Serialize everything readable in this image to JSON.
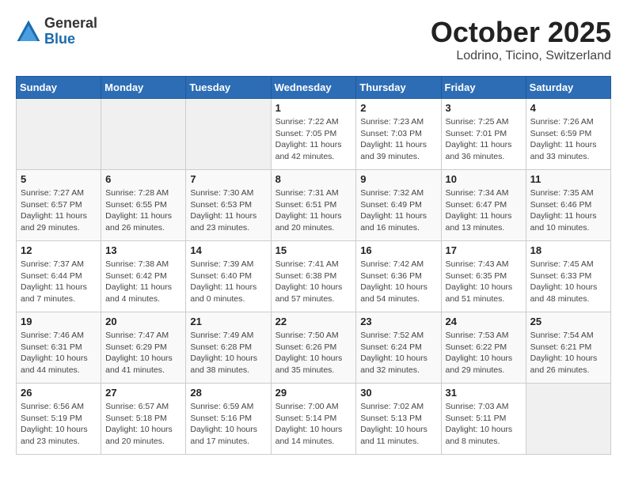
{
  "logo": {
    "general": "General",
    "blue": "Blue"
  },
  "header": {
    "title": "October 2025",
    "subtitle": "Lodrino, Ticino, Switzerland"
  },
  "weekdays": [
    "Sunday",
    "Monday",
    "Tuesday",
    "Wednesday",
    "Thursday",
    "Friday",
    "Saturday"
  ],
  "weeks": [
    [
      {
        "day": "",
        "info": ""
      },
      {
        "day": "",
        "info": ""
      },
      {
        "day": "",
        "info": ""
      },
      {
        "day": "1",
        "info": "Sunrise: 7:22 AM\nSunset: 7:05 PM\nDaylight: 11 hours\nand 42 minutes."
      },
      {
        "day": "2",
        "info": "Sunrise: 7:23 AM\nSunset: 7:03 PM\nDaylight: 11 hours\nand 39 minutes."
      },
      {
        "day": "3",
        "info": "Sunrise: 7:25 AM\nSunset: 7:01 PM\nDaylight: 11 hours\nand 36 minutes."
      },
      {
        "day": "4",
        "info": "Sunrise: 7:26 AM\nSunset: 6:59 PM\nDaylight: 11 hours\nand 33 minutes."
      }
    ],
    [
      {
        "day": "5",
        "info": "Sunrise: 7:27 AM\nSunset: 6:57 PM\nDaylight: 11 hours\nand 29 minutes."
      },
      {
        "day": "6",
        "info": "Sunrise: 7:28 AM\nSunset: 6:55 PM\nDaylight: 11 hours\nand 26 minutes."
      },
      {
        "day": "7",
        "info": "Sunrise: 7:30 AM\nSunset: 6:53 PM\nDaylight: 11 hours\nand 23 minutes."
      },
      {
        "day": "8",
        "info": "Sunrise: 7:31 AM\nSunset: 6:51 PM\nDaylight: 11 hours\nand 20 minutes."
      },
      {
        "day": "9",
        "info": "Sunrise: 7:32 AM\nSunset: 6:49 PM\nDaylight: 11 hours\nand 16 minutes."
      },
      {
        "day": "10",
        "info": "Sunrise: 7:34 AM\nSunset: 6:47 PM\nDaylight: 11 hours\nand 13 minutes."
      },
      {
        "day": "11",
        "info": "Sunrise: 7:35 AM\nSunset: 6:46 PM\nDaylight: 11 hours\nand 10 minutes."
      }
    ],
    [
      {
        "day": "12",
        "info": "Sunrise: 7:37 AM\nSunset: 6:44 PM\nDaylight: 11 hours\nand 7 minutes."
      },
      {
        "day": "13",
        "info": "Sunrise: 7:38 AM\nSunset: 6:42 PM\nDaylight: 11 hours\nand 4 minutes."
      },
      {
        "day": "14",
        "info": "Sunrise: 7:39 AM\nSunset: 6:40 PM\nDaylight: 11 hours\nand 0 minutes."
      },
      {
        "day": "15",
        "info": "Sunrise: 7:41 AM\nSunset: 6:38 PM\nDaylight: 10 hours\nand 57 minutes."
      },
      {
        "day": "16",
        "info": "Sunrise: 7:42 AM\nSunset: 6:36 PM\nDaylight: 10 hours\nand 54 minutes."
      },
      {
        "day": "17",
        "info": "Sunrise: 7:43 AM\nSunset: 6:35 PM\nDaylight: 10 hours\nand 51 minutes."
      },
      {
        "day": "18",
        "info": "Sunrise: 7:45 AM\nSunset: 6:33 PM\nDaylight: 10 hours\nand 48 minutes."
      }
    ],
    [
      {
        "day": "19",
        "info": "Sunrise: 7:46 AM\nSunset: 6:31 PM\nDaylight: 10 hours\nand 44 minutes."
      },
      {
        "day": "20",
        "info": "Sunrise: 7:47 AM\nSunset: 6:29 PM\nDaylight: 10 hours\nand 41 minutes."
      },
      {
        "day": "21",
        "info": "Sunrise: 7:49 AM\nSunset: 6:28 PM\nDaylight: 10 hours\nand 38 minutes."
      },
      {
        "day": "22",
        "info": "Sunrise: 7:50 AM\nSunset: 6:26 PM\nDaylight: 10 hours\nand 35 minutes."
      },
      {
        "day": "23",
        "info": "Sunrise: 7:52 AM\nSunset: 6:24 PM\nDaylight: 10 hours\nand 32 minutes."
      },
      {
        "day": "24",
        "info": "Sunrise: 7:53 AM\nSunset: 6:22 PM\nDaylight: 10 hours\nand 29 minutes."
      },
      {
        "day": "25",
        "info": "Sunrise: 7:54 AM\nSunset: 6:21 PM\nDaylight: 10 hours\nand 26 minutes."
      }
    ],
    [
      {
        "day": "26",
        "info": "Sunrise: 6:56 AM\nSunset: 5:19 PM\nDaylight: 10 hours\nand 23 minutes."
      },
      {
        "day": "27",
        "info": "Sunrise: 6:57 AM\nSunset: 5:18 PM\nDaylight: 10 hours\nand 20 minutes."
      },
      {
        "day": "28",
        "info": "Sunrise: 6:59 AM\nSunset: 5:16 PM\nDaylight: 10 hours\nand 17 minutes."
      },
      {
        "day": "29",
        "info": "Sunrise: 7:00 AM\nSunset: 5:14 PM\nDaylight: 10 hours\nand 14 minutes."
      },
      {
        "day": "30",
        "info": "Sunrise: 7:02 AM\nSunset: 5:13 PM\nDaylight: 10 hours\nand 11 minutes."
      },
      {
        "day": "31",
        "info": "Sunrise: 7:03 AM\nSunset: 5:11 PM\nDaylight: 10 hours\nand 8 minutes."
      },
      {
        "day": "",
        "info": ""
      }
    ]
  ]
}
